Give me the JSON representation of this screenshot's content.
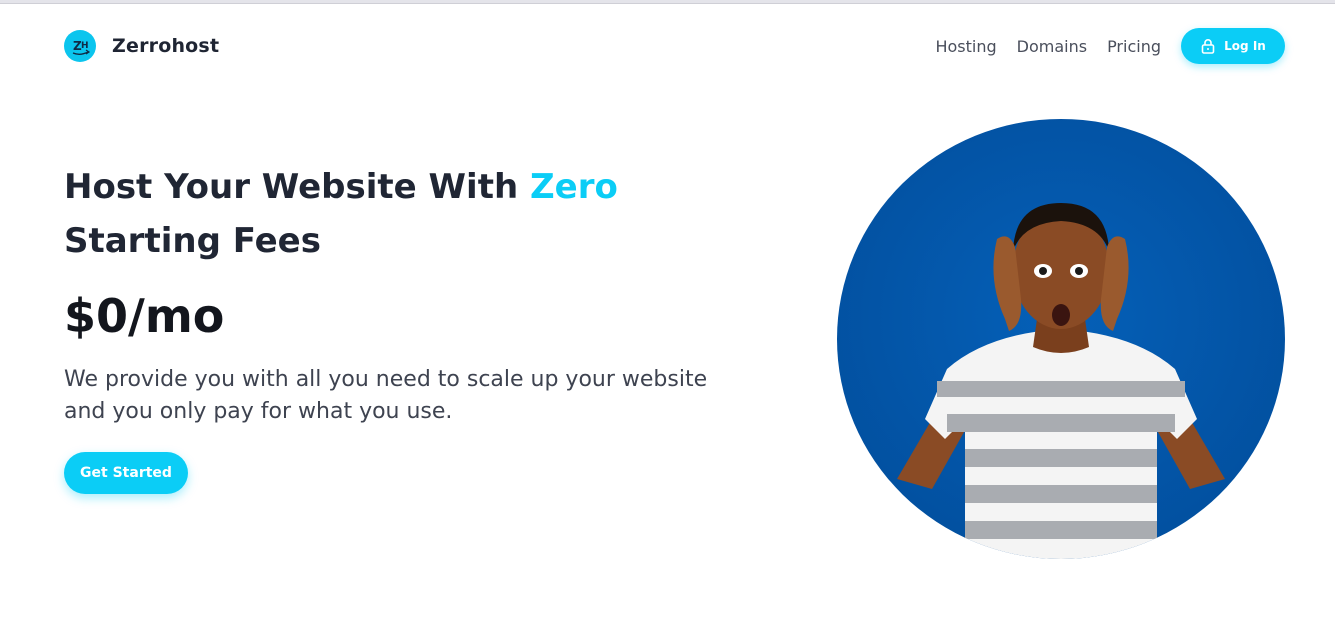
{
  "header": {
    "brand_name": "Zerrohost",
    "logo_text": "ZH",
    "nav": [
      {
        "label": "Hosting"
      },
      {
        "label": "Domains"
      },
      {
        "label": "Pricing"
      }
    ],
    "login_label": "Log In"
  },
  "hero": {
    "title_part1": "Host Your Website With ",
    "title_accent": "Zero",
    "title_part2": "Starting Fees",
    "price": "$0/mo",
    "description": "We provide you with all you need to scale up your website and you only pay for what you use.",
    "cta_label": "Get Started"
  },
  "colors": {
    "accent": "#0bcdf6",
    "heading": "#202634",
    "photo_background": "#0252a3"
  },
  "icons": {
    "logo": "zh-logo-icon",
    "login": "lock-icon"
  }
}
